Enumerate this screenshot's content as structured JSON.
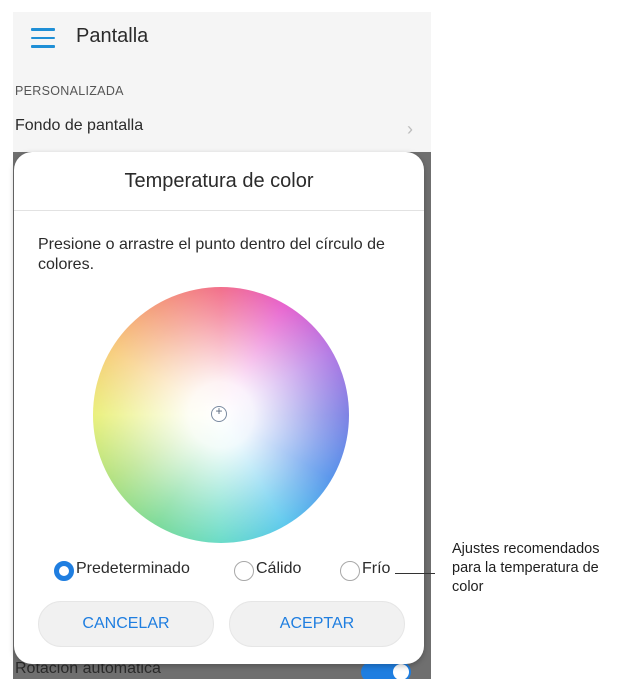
{
  "appbar": {
    "title": "Pantalla",
    "menu_icon": "hamburger-menu-icon"
  },
  "section": {
    "header": "PERSONALIZADA"
  },
  "settings": {
    "wallpaper_label": "Fondo de pantalla",
    "auto_rotate_label": "Rotación automática",
    "auto_rotate_on": true
  },
  "dialog": {
    "title": "Temperatura de color",
    "message": "Presione o arrastre el punto dentro del círculo de colores.",
    "options": [
      {
        "label": "Predeterminado",
        "selected": true
      },
      {
        "label": "Cálido",
        "selected": false
      },
      {
        "label": "Frío",
        "selected": false
      }
    ],
    "cancel_label": "CANCELAR",
    "ok_label": "ACEPTAR"
  },
  "annotation": {
    "text": "Ajustes recomendados para la temperatura de color"
  },
  "colors": {
    "accent": "#1f7ee0",
    "menu": "#1f8fd6"
  }
}
